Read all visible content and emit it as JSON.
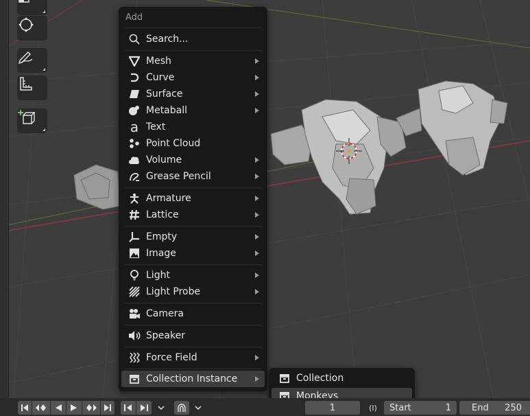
{
  "menu": {
    "title": "Add",
    "search": "Search...",
    "items": [
      {
        "label": "Mesh"
      },
      {
        "label": "Curve"
      },
      {
        "label": "Surface"
      },
      {
        "label": "Metaball"
      },
      {
        "label": "Text"
      },
      {
        "label": "Point Cloud"
      },
      {
        "label": "Volume"
      },
      {
        "label": "Grease Pencil"
      },
      {
        "label": "Armature"
      },
      {
        "label": "Lattice"
      },
      {
        "label": "Empty"
      },
      {
        "label": "Image"
      },
      {
        "label": "Light"
      },
      {
        "label": "Light Probe"
      },
      {
        "label": "Camera"
      },
      {
        "label": "Speaker"
      },
      {
        "label": "Force Field"
      },
      {
        "label": "Collection Instance"
      }
    ]
  },
  "submenu": {
    "items": [
      {
        "label": "Collection"
      },
      {
        "label": "Monkeys"
      }
    ]
  },
  "timeline": {
    "start_label": "Start",
    "start_value": "1",
    "end_label": "End",
    "end_value": "250"
  },
  "colors": {
    "viewport_bg": "#3d3d3d",
    "menu_bg": "#181818",
    "x_axis": "#8c3a3a",
    "y_axis": "#6b8a2d"
  }
}
